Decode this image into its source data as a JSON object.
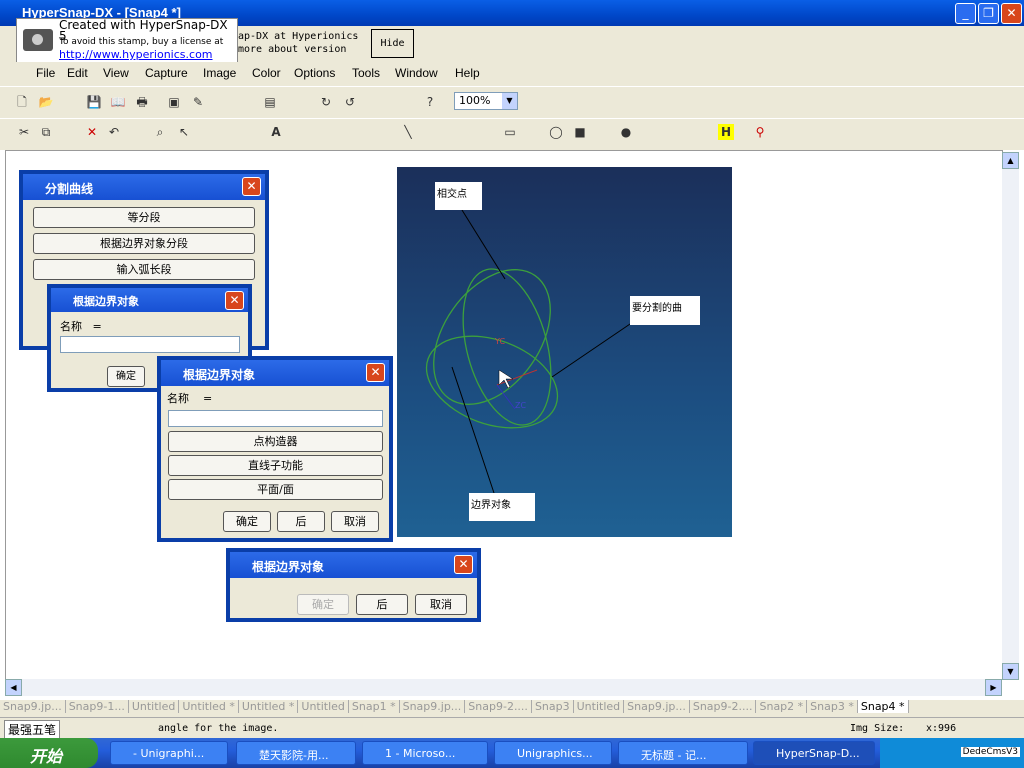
{
  "window": {
    "title": "HyperSnap-DX - [Snap4 *]"
  },
  "stamp": {
    "line1": "Created with HyperSnap-DX 5",
    "line2": "To avoid this stamp, buy a license at",
    "url": "http://www.hyperionics.com"
  },
  "info": {
    "line1": "ap-DX at Hyperionics",
    "line2": "more about version",
    "hide": "Hide"
  },
  "menu": [
    "File",
    "Edit",
    "View",
    "Capture",
    "Image",
    "Color",
    "Options",
    "Tools",
    "Window",
    "Help"
  ],
  "toolbar": {
    "zoom": "100%"
  },
  "dialog1": {
    "title": "分割曲线",
    "buttons": [
      "等分段",
      "根据边界对象分段",
      "输入弧长段"
    ]
  },
  "dialog2": {
    "title": "根据边界对象",
    "name_label": "名称",
    "eq": "=",
    "ok": "确定"
  },
  "dialog3": {
    "title": "根据边界对象",
    "name_label": "名称",
    "eq": "=",
    "buttons": [
      "点构造器",
      "直线子功能",
      "平面/面"
    ],
    "ok": "确定",
    "back": "后",
    "cancel": "取消"
  },
  "dialog4": {
    "title": "根据边界对象",
    "ok": "确定",
    "back": "后",
    "cancel": "取消"
  },
  "viewport": {
    "notes": [
      "相交点",
      "要分割的曲",
      "边界对象"
    ],
    "axis_yc": "YC",
    "axis_zc": "ZC"
  },
  "tabs": [
    "Snap9.jp...",
    "Snap9-1...",
    "Untitled",
    "Untitled *",
    "Untitled *",
    "Untitled",
    "Snap1 *",
    "Snap9.jp...",
    "Snap9-2....",
    "Snap3",
    "Untitled",
    "Snap9.jp...",
    "Snap9-2....",
    "Snap2 *",
    "Snap3 *",
    "Snap4 *"
  ],
  "status": {
    "ime": "最强五笔",
    "text": "angle for the image.",
    "size_label": "Img Size:",
    "size_value": "x:996"
  },
  "taskbar": {
    "start": "开始",
    "items": [
      "- Unigraphi...",
      "楚天影院-用...",
      "1 - Microso...",
      "Unigraphics...",
      "无标题 - 记...",
      "HyperSnap-D..."
    ],
    "tray": "DedeCmsV3"
  },
  "colors": {
    "accent": "#0a3ea8",
    "viewport": "#1c4d80"
  }
}
